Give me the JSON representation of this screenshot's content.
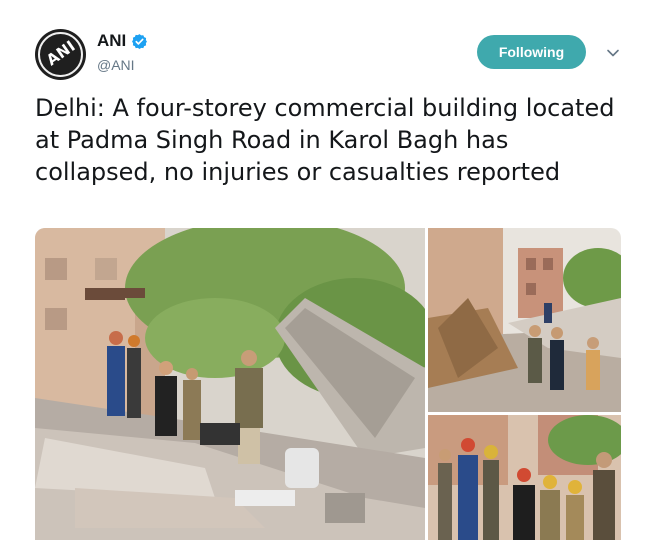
{
  "account": {
    "name": "ANI",
    "handle": "@ANI",
    "avatar_logo_text": "ANI",
    "verified": true
  },
  "actions": {
    "follow_label": "Following",
    "more_icon": "chevron-down-icon"
  },
  "tweet": {
    "text": "Delhi: A four-storey commercial building located at Padma Singh Road in Karol Bagh has collapsed, no injuries or casualties reported"
  },
  "colors": {
    "follow_button": "#3fa9ad",
    "verified_badge": "#1da1f2",
    "handle_gray": "#657786"
  }
}
